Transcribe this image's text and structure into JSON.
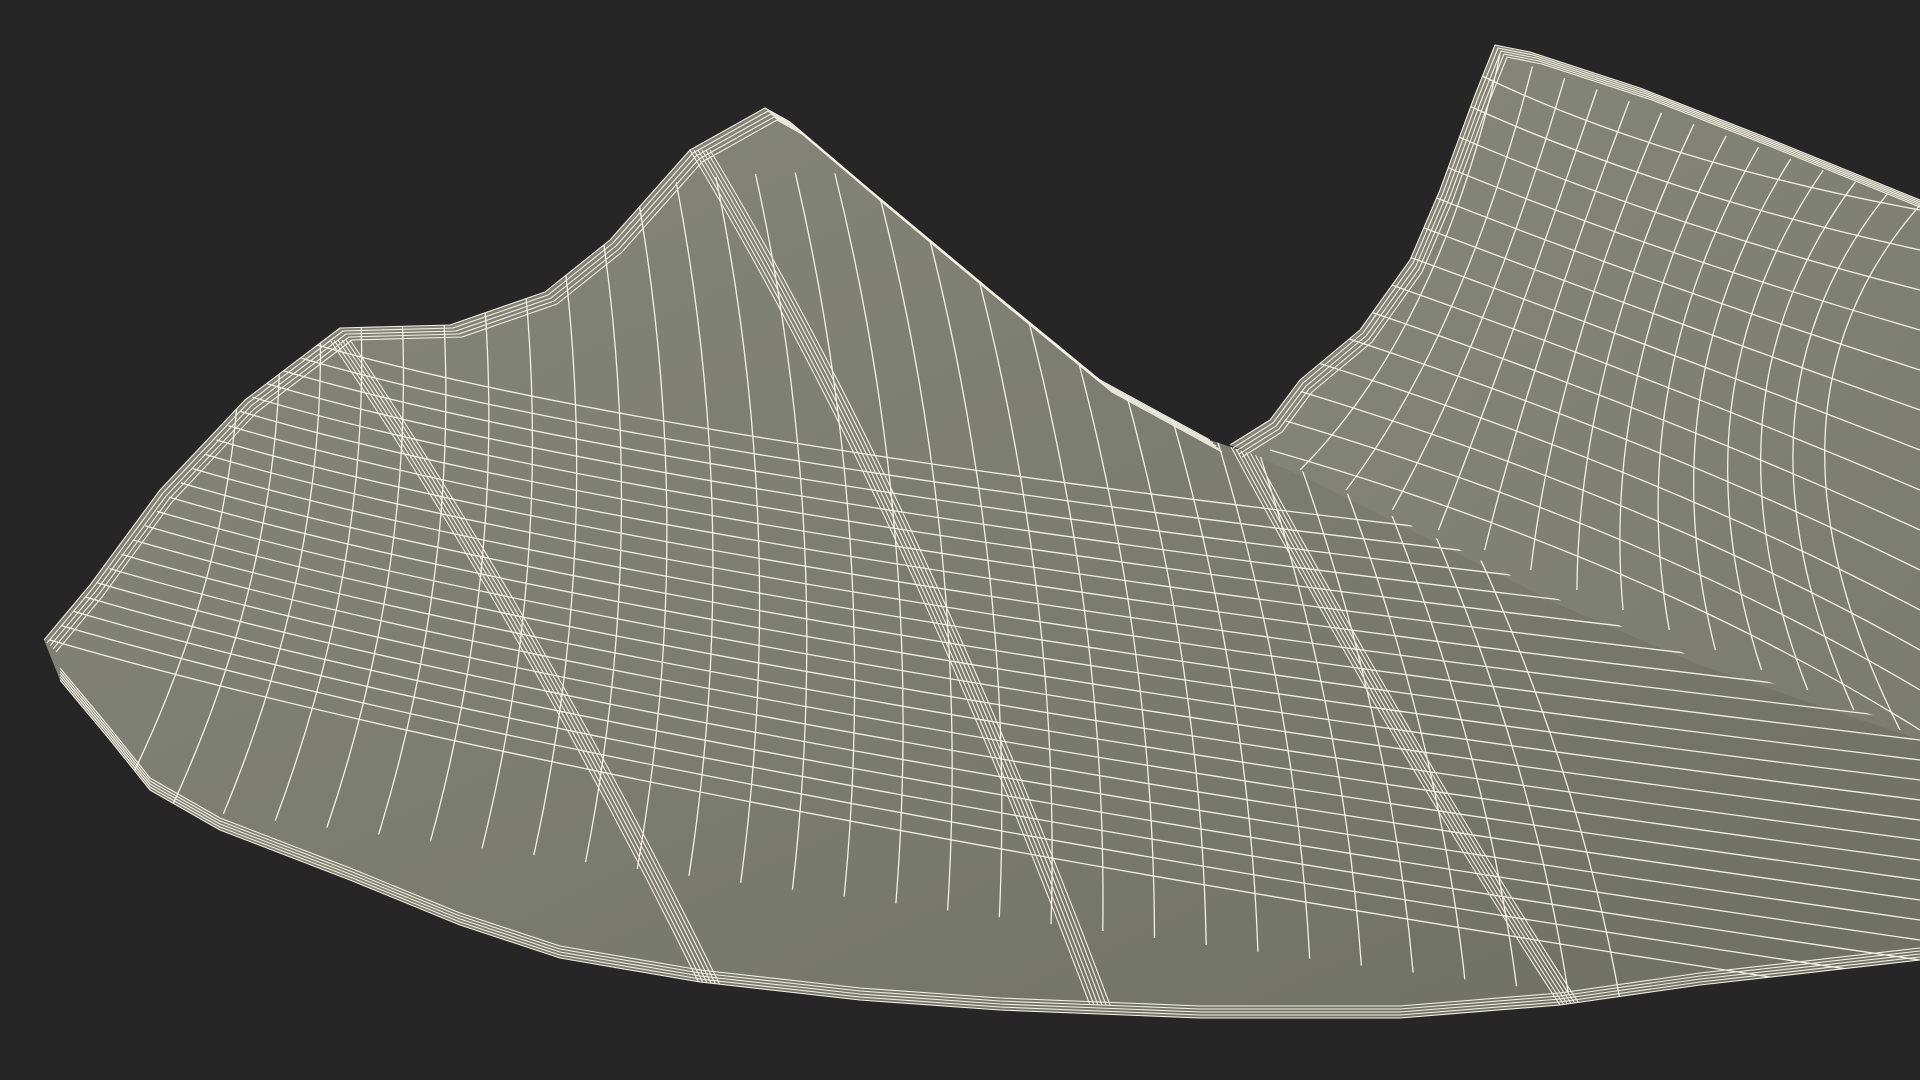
{
  "scene": {
    "background_color": "#262626",
    "surface_color": "#7b7c70",
    "surface_highlight_color": "#86877b",
    "surface_shadow_color": "#6e6f64",
    "wire_color": "#f2f0e2",
    "render_style": "wireframe-on-shaded"
  }
}
